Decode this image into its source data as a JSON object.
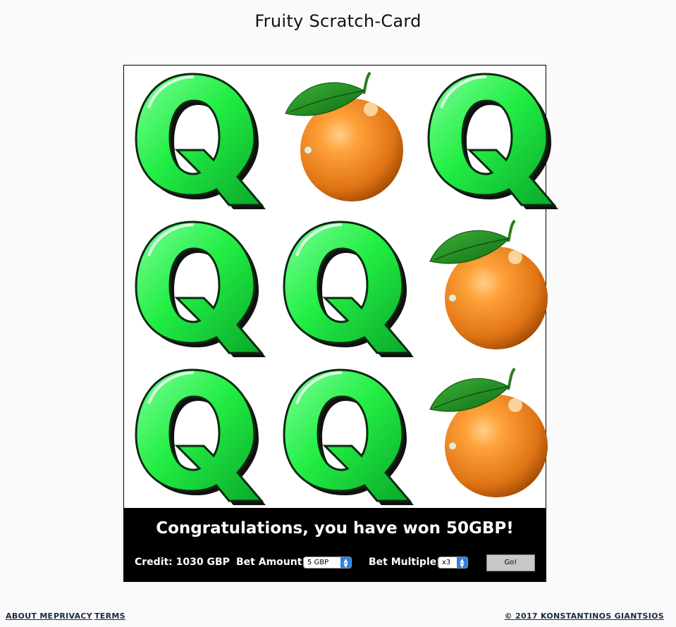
{
  "title": "Fruity Scratch-Card",
  "grid": {
    "cells": [
      {
        "symbol": "q-icon"
      },
      {
        "symbol": "orange-icon"
      },
      {
        "symbol": "q-icon"
      },
      {
        "symbol": "q-icon"
      },
      {
        "symbol": "q-icon"
      },
      {
        "symbol": "orange-icon"
      },
      {
        "symbol": "q-icon"
      },
      {
        "symbol": "q-icon"
      },
      {
        "symbol": "orange-icon"
      }
    ]
  },
  "result": {
    "message": "Congratulations, you have won 50GBP!"
  },
  "controls": {
    "credit_label": "Credit: 1030 GBP",
    "bet_amount_label": "Bet Amount:",
    "bet_amount_value": "5 GBP",
    "bet_multiple_label": "Bet Multiple:",
    "bet_multiple_value": "x3",
    "go_label": "Go!"
  },
  "footer": {
    "links": [
      "ABOUT ME",
      "PRIVACY",
      "TERMS"
    ],
    "copyright": "© 2017 KONSTANTINOS GIANTSIOS"
  },
  "colors": {
    "q_green": "#22ee44",
    "orange": "#f08a20",
    "leaf": "#1e8c1e",
    "panel": "#000000",
    "accent_select": "#2f7fe8"
  }
}
